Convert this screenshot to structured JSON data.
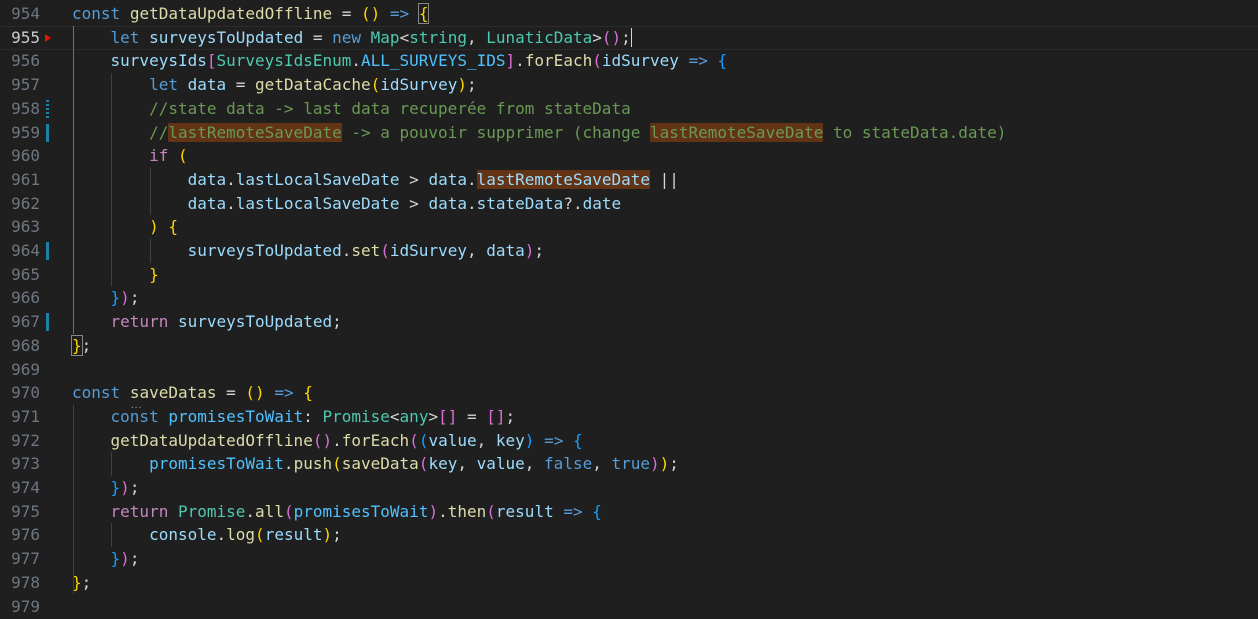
{
  "editor": {
    "lines": [
      {
        "n": "954",
        "segs": [
          [
            "const",
            "kw"
          ],
          [
            " ",
            "pn"
          ],
          [
            "getDataUpdatedOffline",
            "fn"
          ],
          [
            " = ",
            "pn"
          ],
          [
            "()",
            "b1"
          ],
          [
            " ",
            "pn"
          ],
          [
            "=>",
            "kw"
          ],
          [
            " ",
            "pn"
          ],
          [
            "{",
            "b1 boxed"
          ]
        ]
      },
      {
        "n": "955",
        "segs": [
          [
            "    ",
            "pn"
          ],
          [
            "let",
            "kw"
          ],
          [
            " ",
            "pn"
          ],
          [
            "surveysToUpdated",
            "var"
          ],
          [
            " = ",
            "pn"
          ],
          [
            "new",
            "kw"
          ],
          [
            " ",
            "pn"
          ],
          [
            "Map",
            "ty"
          ],
          [
            "<",
            "pn"
          ],
          [
            "string",
            "ty"
          ],
          [
            ", ",
            "pn"
          ],
          [
            "LunaticData",
            "ty"
          ],
          [
            ">",
            "pn"
          ],
          [
            "()",
            "b2"
          ],
          [
            ";",
            "pn cursor"
          ]
        ]
      },
      {
        "n": "956",
        "segs": [
          [
            "    ",
            "pn"
          ],
          [
            "surveysIds",
            "var"
          ],
          [
            "[",
            "b2"
          ],
          [
            "SurveysIdsEnum",
            "ty"
          ],
          [
            ".",
            "pn"
          ],
          [
            "ALL_SURVEYS_IDS",
            "cst"
          ],
          [
            "]",
            "b2"
          ],
          [
            ".",
            "pn"
          ],
          [
            "forEach",
            "fn"
          ],
          [
            "(",
            "b2"
          ],
          [
            "idSurvey",
            "var"
          ],
          [
            " ",
            "pn"
          ],
          [
            "=>",
            "kw"
          ],
          [
            " ",
            "pn"
          ],
          [
            "{",
            "b3"
          ]
        ]
      },
      {
        "n": "957",
        "segs": [
          [
            "        ",
            "pn"
          ],
          [
            "let",
            "kw"
          ],
          [
            " ",
            "pn"
          ],
          [
            "data",
            "var"
          ],
          [
            " = ",
            "pn"
          ],
          [
            "getDataCache",
            "fn"
          ],
          [
            "(",
            "b1"
          ],
          [
            "idSurvey",
            "var"
          ],
          [
            ")",
            "b1"
          ],
          [
            ";",
            "pn"
          ]
        ]
      },
      {
        "n": "958",
        "segs": [
          [
            "        ",
            "pn"
          ],
          [
            "//state data -> last data recuperée from stateData",
            "cm"
          ]
        ]
      },
      {
        "n": "959",
        "segs": [
          [
            "        ",
            "pn"
          ],
          [
            "//",
            "cm"
          ],
          [
            "lastRemoteSaveDate",
            "cm hl"
          ],
          [
            " -> a pouvoir supprimer (change ",
            "cm"
          ],
          [
            "lastRemoteSaveDate",
            "cm hl"
          ],
          [
            " to stateData.date)",
            "cm"
          ]
        ]
      },
      {
        "n": "960",
        "segs": [
          [
            "        ",
            "pn"
          ],
          [
            "if",
            "kwc"
          ],
          [
            " ",
            "pn"
          ],
          [
            "(",
            "b1"
          ]
        ]
      },
      {
        "n": "961",
        "segs": [
          [
            "            ",
            "pn"
          ],
          [
            "data",
            "var"
          ],
          [
            ".",
            "pn"
          ],
          [
            "lastLocalSaveDate",
            "var"
          ],
          [
            " > ",
            "pn"
          ],
          [
            "data",
            "var"
          ],
          [
            ".",
            "pn"
          ],
          [
            "lastRemoteSaveDate",
            "var hl"
          ],
          [
            " ||",
            "pn"
          ]
        ]
      },
      {
        "n": "962",
        "segs": [
          [
            "            ",
            "pn"
          ],
          [
            "data",
            "var"
          ],
          [
            ".",
            "pn"
          ],
          [
            "lastLocalSaveDate",
            "var"
          ],
          [
            " > ",
            "pn"
          ],
          [
            "data",
            "var"
          ],
          [
            ".",
            "pn"
          ],
          [
            "stateData",
            "var"
          ],
          [
            "?.",
            "pn"
          ],
          [
            "date",
            "var"
          ]
        ]
      },
      {
        "n": "963",
        "segs": [
          [
            "        ",
            "pn"
          ],
          [
            ")",
            "b1"
          ],
          [
            " ",
            "pn"
          ],
          [
            "{",
            "b1"
          ]
        ]
      },
      {
        "n": "964",
        "segs": [
          [
            "            ",
            "pn"
          ],
          [
            "surveysToUpdated",
            "var"
          ],
          [
            ".",
            "pn"
          ],
          [
            "set",
            "fn"
          ],
          [
            "(",
            "b2"
          ],
          [
            "idSurvey",
            "var"
          ],
          [
            ", ",
            "pn"
          ],
          [
            "data",
            "var"
          ],
          [
            ")",
            "b2"
          ],
          [
            ";",
            "pn"
          ]
        ]
      },
      {
        "n": "965",
        "segs": [
          [
            "        ",
            "pn"
          ],
          [
            "}",
            "b1"
          ]
        ]
      },
      {
        "n": "966",
        "segs": [
          [
            "    ",
            "pn"
          ],
          [
            "}",
            "b3"
          ],
          [
            ")",
            "b2"
          ],
          [
            ";",
            "pn"
          ]
        ]
      },
      {
        "n": "967",
        "segs": [
          [
            "    ",
            "pn"
          ],
          [
            "return",
            "kwc"
          ],
          [
            " ",
            "pn"
          ],
          [
            "surveysToUpdated",
            "var"
          ],
          [
            ";",
            "pn"
          ]
        ]
      },
      {
        "n": "968",
        "segs": [
          [
            "}",
            "b1 boxed"
          ],
          [
            ";",
            "pn"
          ]
        ]
      },
      {
        "n": "969",
        "segs": []
      },
      {
        "n": "970",
        "segs": [
          [
            "const",
            "kw"
          ],
          [
            " ",
            "pn"
          ],
          [
            "saveDatas",
            "fn dots"
          ],
          [
            " = ",
            "pn"
          ],
          [
            "()",
            "b1"
          ],
          [
            " ",
            "pn"
          ],
          [
            "=>",
            "kw"
          ],
          [
            " ",
            "pn"
          ],
          [
            "{",
            "b1"
          ]
        ]
      },
      {
        "n": "971",
        "segs": [
          [
            "    ",
            "pn"
          ],
          [
            "const",
            "kw"
          ],
          [
            " ",
            "pn"
          ],
          [
            "promisesToWait",
            "cst"
          ],
          [
            ": ",
            "pn"
          ],
          [
            "Promise",
            "ty"
          ],
          [
            "<",
            "pn"
          ],
          [
            "any",
            "ty"
          ],
          [
            ">",
            "pn"
          ],
          [
            "[]",
            "b2"
          ],
          [
            " = ",
            "pn"
          ],
          [
            "[]",
            "b2"
          ],
          [
            ";",
            "pn"
          ]
        ]
      },
      {
        "n": "972",
        "segs": [
          [
            "    ",
            "pn"
          ],
          [
            "getDataUpdatedOffline",
            "fn"
          ],
          [
            "()",
            "b2"
          ],
          [
            ".",
            "pn"
          ],
          [
            "forEach",
            "fn"
          ],
          [
            "(",
            "b2"
          ],
          [
            "(",
            "b3"
          ],
          [
            "value",
            "var"
          ],
          [
            ", ",
            "pn"
          ],
          [
            "key",
            "var"
          ],
          [
            ")",
            "b3"
          ],
          [
            " ",
            "pn"
          ],
          [
            "=>",
            "kw"
          ],
          [
            " ",
            "pn"
          ],
          [
            "{",
            "b3"
          ]
        ]
      },
      {
        "n": "973",
        "segs": [
          [
            "        ",
            "pn"
          ],
          [
            "promisesToWait",
            "cst"
          ],
          [
            ".",
            "pn"
          ],
          [
            "push",
            "fn"
          ],
          [
            "(",
            "b1"
          ],
          [
            "saveData",
            "fn"
          ],
          [
            "(",
            "b2"
          ],
          [
            "key",
            "var"
          ],
          [
            ", ",
            "pn"
          ],
          [
            "value",
            "var"
          ],
          [
            ", ",
            "pn"
          ],
          [
            "false",
            "kw"
          ],
          [
            ", ",
            "pn"
          ],
          [
            "true",
            "kw"
          ],
          [
            ")",
            "b2"
          ],
          [
            ")",
            "b1"
          ],
          [
            ";",
            "pn"
          ]
        ]
      },
      {
        "n": "974",
        "segs": [
          [
            "    ",
            "pn"
          ],
          [
            "}",
            "b3"
          ],
          [
            ")",
            "b2"
          ],
          [
            ";",
            "pn"
          ]
        ]
      },
      {
        "n": "975",
        "segs": [
          [
            "    ",
            "pn"
          ],
          [
            "return",
            "kwc"
          ],
          [
            " ",
            "pn"
          ],
          [
            "Promise",
            "ty"
          ],
          [
            ".",
            "pn"
          ],
          [
            "all",
            "fn"
          ],
          [
            "(",
            "b2"
          ],
          [
            "promisesToWait",
            "cst"
          ],
          [
            ")",
            "b2"
          ],
          [
            ".",
            "pn"
          ],
          [
            "then",
            "fn"
          ],
          [
            "(",
            "b2"
          ],
          [
            "result",
            "var"
          ],
          [
            " ",
            "pn"
          ],
          [
            "=>",
            "kw"
          ],
          [
            " ",
            "pn"
          ],
          [
            "{",
            "b3"
          ]
        ]
      },
      {
        "n": "976",
        "segs": [
          [
            "        ",
            "pn"
          ],
          [
            "console",
            "var"
          ],
          [
            ".",
            "pn"
          ],
          [
            "log",
            "fn"
          ],
          [
            "(",
            "b1"
          ],
          [
            "result",
            "var"
          ],
          [
            ")",
            "b1"
          ],
          [
            ";",
            "pn"
          ]
        ]
      },
      {
        "n": "977",
        "segs": [
          [
            "    ",
            "pn"
          ],
          [
            "}",
            "b3"
          ],
          [
            ")",
            "b2"
          ],
          [
            ";",
            "pn"
          ]
        ]
      },
      {
        "n": "978",
        "segs": [
          [
            "}",
            "b1"
          ],
          [
            ";",
            "pn"
          ]
        ]
      },
      {
        "n": "979",
        "segs": []
      }
    ],
    "active_line": "955",
    "breakpoint_line": "955",
    "modified_lines": [
      "958",
      "959",
      "964",
      "967"
    ],
    "theme_colors": {
      "background": "#1f1f1f",
      "keyword": "#569cd6",
      "control": "#c586c0",
      "function": "#dcdcaa",
      "variable": "#9cdcfe",
      "type": "#4ec9b0",
      "constant": "#4fc1ff",
      "comment": "#6a9955",
      "highlight": "#623315"
    }
  }
}
